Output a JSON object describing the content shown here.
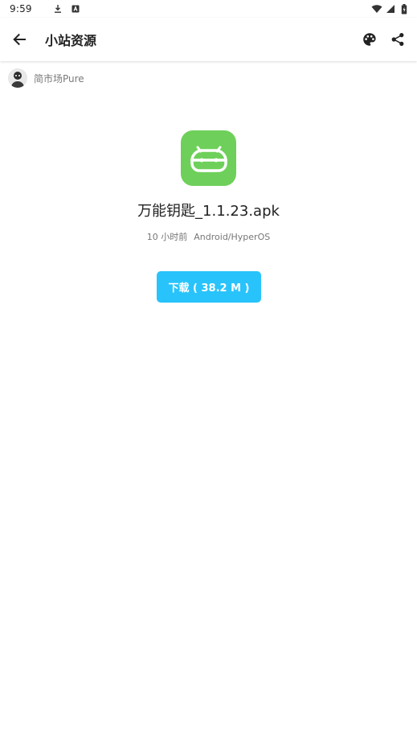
{
  "status_bar": {
    "time": "9:59",
    "icons": [
      "download-icon",
      "notification-a-icon",
      "wifi-icon",
      "signal-icon",
      "battery-icon"
    ]
  },
  "app_bar": {
    "title": "小站资源",
    "back_icon": "arrow-back-icon",
    "theme_icon": "palette-icon",
    "share_icon": "share-icon"
  },
  "source": {
    "name": "简市场Pure",
    "avatar_icon": "avatar"
  },
  "file": {
    "icon": "android-icon",
    "name": "万能钥匙_1.1.23.apk",
    "time": "10 小时前",
    "platform": "Android/HyperOS"
  },
  "download": {
    "label": "下载 ( 38.2 M )"
  },
  "colors": {
    "accent": "#29c3fb",
    "icon_bg": "#6ed05a",
    "text_primary": "#222222",
    "text_secondary": "#777777"
  }
}
